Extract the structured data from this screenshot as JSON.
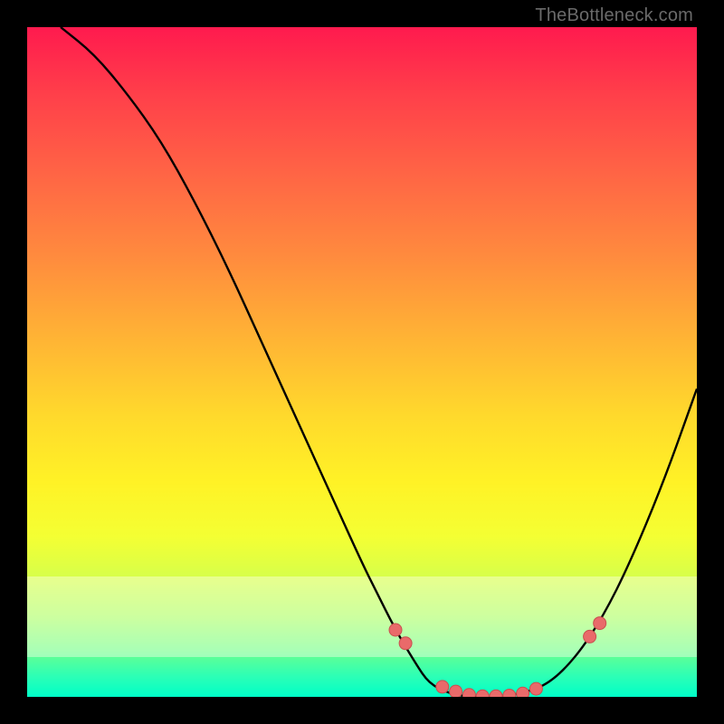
{
  "watermark": "TheBottleneck.com",
  "colors": {
    "curve": "#000000",
    "dot_fill": "#e96a6a",
    "dot_stroke": "#c94f4f",
    "background": "#000000"
  },
  "chart_data": {
    "type": "line",
    "title": "",
    "xlabel": "",
    "ylabel": "",
    "xlim": [
      0,
      100
    ],
    "ylim": [
      0,
      100
    ],
    "grid": false,
    "legend": false,
    "curve": {
      "name": "bottleneck-curve",
      "x": [
        5,
        10,
        15,
        20,
        25,
        30,
        35,
        40,
        45,
        50,
        52,
        55,
        58,
        60,
        63,
        66,
        70,
        74,
        78,
        82,
        86,
        90,
        95,
        100
      ],
      "y": [
        100,
        96,
        90,
        83,
        74,
        64,
        53,
        42,
        31,
        20,
        16,
        10,
        5,
        2,
        0.5,
        0,
        0,
        0.5,
        2,
        6,
        12,
        20,
        32,
        46
      ]
    },
    "dots": {
      "name": "highlight-points",
      "x": [
        55,
        56.5,
        62,
        64,
        66,
        68,
        70,
        72,
        74,
        76,
        84,
        85.5
      ],
      "y": [
        10,
        8,
        1.5,
        0.8,
        0.3,
        0.1,
        0.1,
        0.2,
        0.5,
        1.2,
        9,
        11
      ]
    },
    "pale_band_y": [
      6,
      18
    ]
  }
}
